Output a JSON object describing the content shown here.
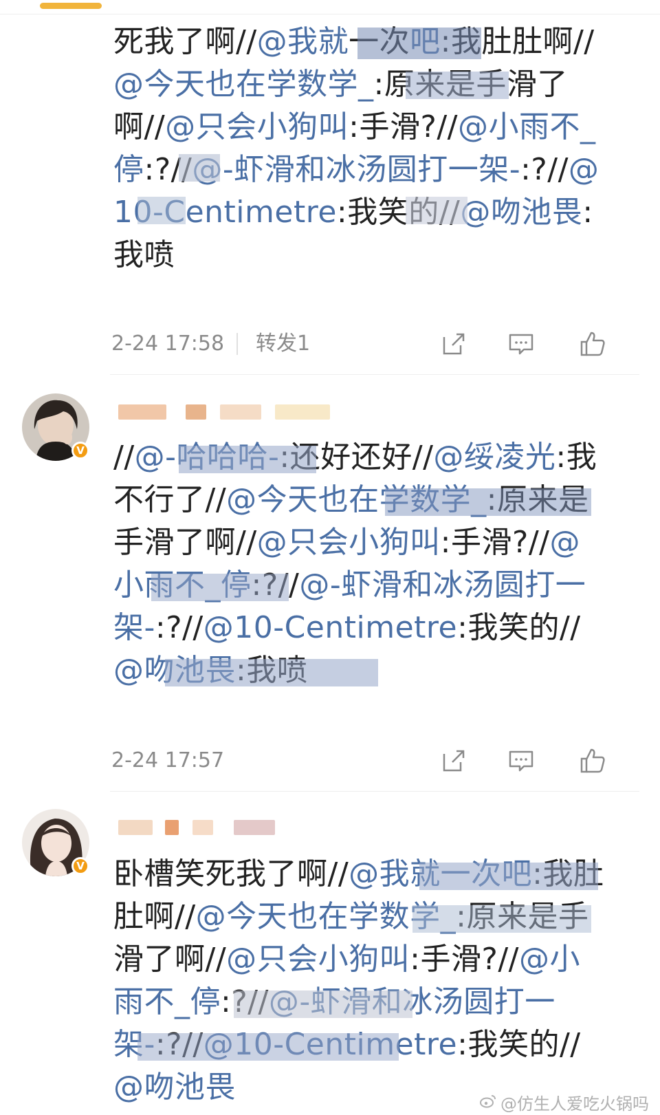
{
  "posts": [
    {
      "text": [
        {
          "k": "t",
          "v": "死我了啊//"
        },
        {
          "k": "m",
          "v": "@我就"
        },
        {
          "k": "t",
          "v": "一次"
        },
        {
          "k": "m",
          "v": "吧"
        },
        {
          "k": "t",
          "v": ":我肚肚啊//"
        },
        {
          "k": "m",
          "v": "@今天也在学数学_"
        },
        {
          "k": "t",
          "v": ":原来是手滑了啊//"
        },
        {
          "k": "m",
          "v": "@只会小狗叫"
        },
        {
          "k": "t",
          "v": ":手滑?//"
        },
        {
          "k": "m",
          "v": "@小雨不_停"
        },
        {
          "k": "t",
          "v": ":?//"
        },
        {
          "k": "m",
          "v": "@-虾滑和冰汤圆打一架-"
        },
        {
          "k": "t",
          "v": ":?//"
        },
        {
          "k": "m",
          "v": "@10-Centimetre"
        },
        {
          "k": "t",
          "v": ":我笑的//"
        },
        {
          "k": "m",
          "v": "@吻池畏"
        },
        {
          "k": "t",
          "v": ":我喷"
        }
      ],
      "time": "2-24 17:58",
      "repost": "转发1"
    },
    {
      "text": [
        {
          "k": "t",
          "v": "//"
        },
        {
          "k": "m",
          "v": "@-哈哈哈-"
        },
        {
          "k": "t",
          "v": ":还好还好//"
        },
        {
          "k": "m",
          "v": "@绥凌光"
        },
        {
          "k": "t",
          "v": ":我不行了//"
        },
        {
          "k": "m",
          "v": "@今天也在学数学_"
        },
        {
          "k": "t",
          "v": ":原来是手滑了啊//"
        },
        {
          "k": "m",
          "v": "@只会小狗叫"
        },
        {
          "k": "t",
          "v": ":手滑?//"
        },
        {
          "k": "m",
          "v": "@小雨不_停"
        },
        {
          "k": "t",
          "v": ":?//"
        },
        {
          "k": "m",
          "v": "@-虾滑和冰汤圆打一架-"
        },
        {
          "k": "t",
          "v": ":?//"
        },
        {
          "k": "m",
          "v": "@10-Centimetre"
        },
        {
          "k": "t",
          "v": ":我笑的//"
        },
        {
          "k": "m",
          "v": "@吻池畏"
        },
        {
          "k": "t",
          "v": ":我喷"
        }
      ],
      "time": "2-24 17:57"
    },
    {
      "text": [
        {
          "k": "t",
          "v": "卧槽笑死我了啊//"
        },
        {
          "k": "m",
          "v": "@我就一次吧"
        },
        {
          "k": "t",
          "v": ":我肚肚啊//"
        },
        {
          "k": "m",
          "v": "@今天也在学数学_"
        },
        {
          "k": "t",
          "v": ":原来是手滑了啊//"
        },
        {
          "k": "m",
          "v": "@只会小狗叫"
        },
        {
          "k": "t",
          "v": ":手滑?//"
        },
        {
          "k": "m",
          "v": "@小雨不_停"
        },
        {
          "k": "t",
          "v": ":?//"
        },
        {
          "k": "m",
          "v": "@-虾滑和冰汤圆打一架-"
        },
        {
          "k": "t",
          "v": ":?//"
        },
        {
          "k": "m",
          "v": "@10-Centimetre"
        },
        {
          "k": "t",
          "v": ":我笑的//"
        },
        {
          "k": "m",
          "v": "@吻池畏"
        }
      ]
    }
  ],
  "icons": [
    "share-icon",
    "comment-icon",
    "like-icon"
  ],
  "colors": {
    "mention": "#4a6fa5",
    "accent": "#f1b43b",
    "badge": "#f39c12",
    "meta": "#8a8a8a"
  },
  "watermark": "@仿生人爱吃火锅吗"
}
